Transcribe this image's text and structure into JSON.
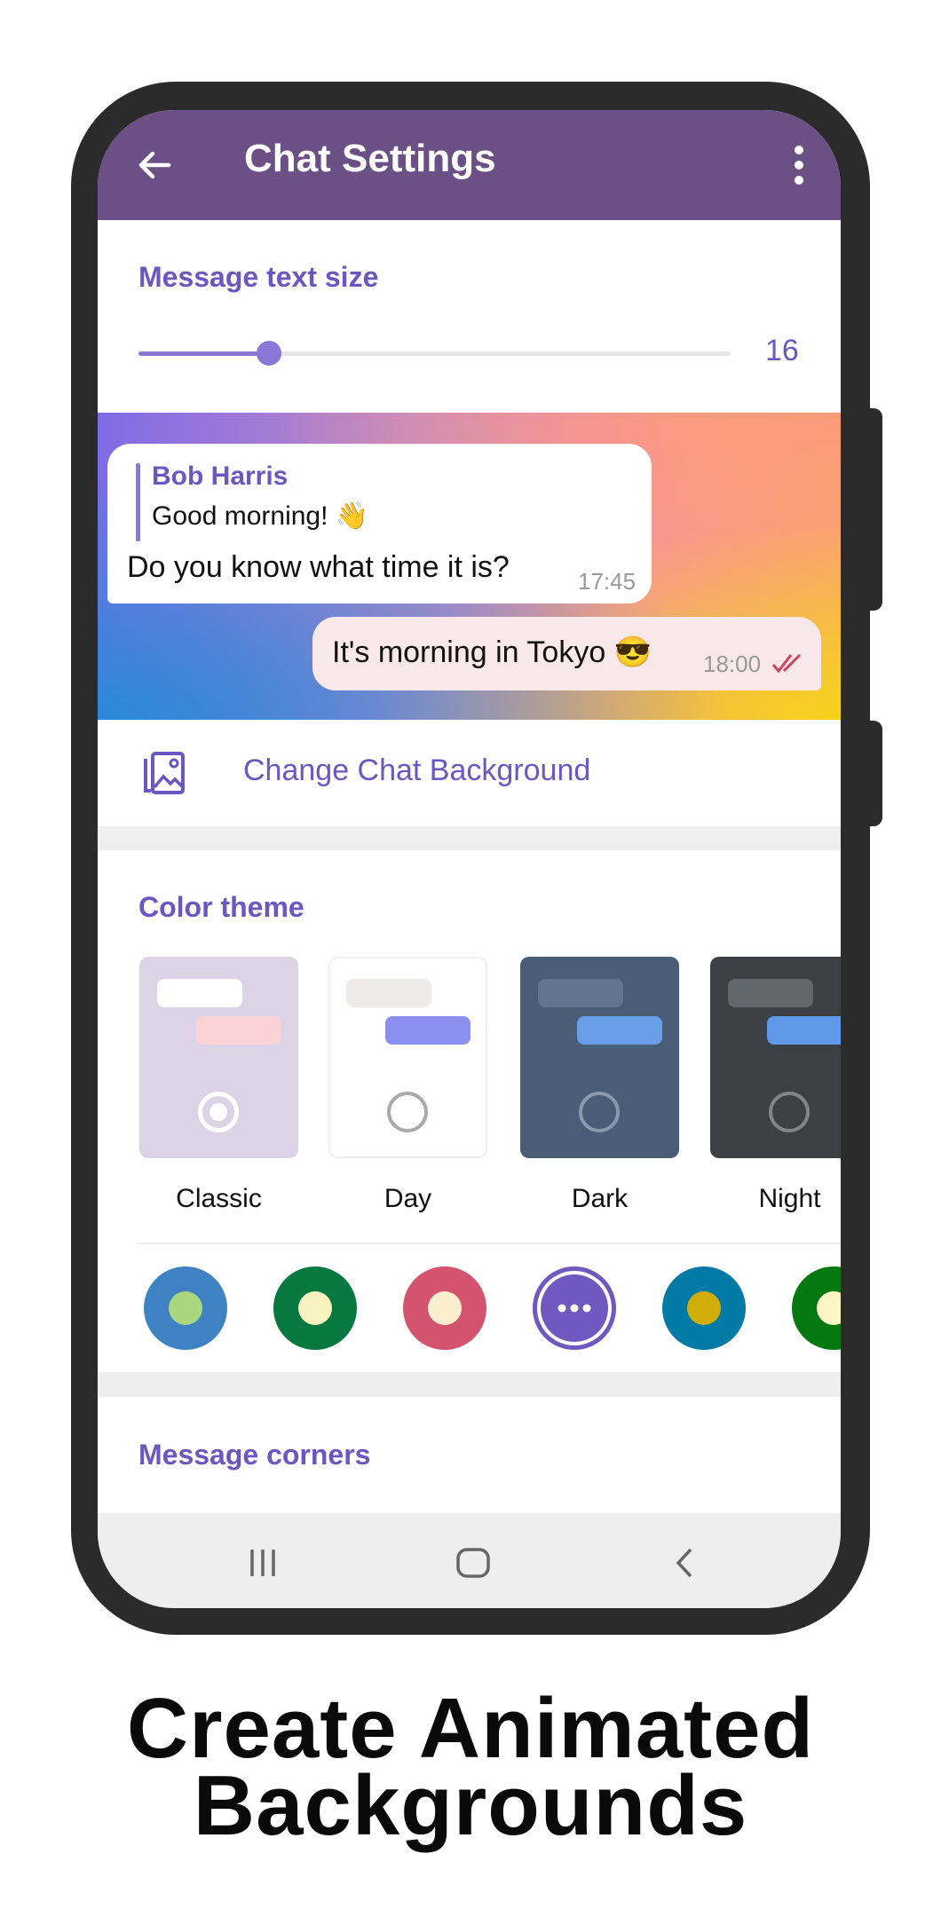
{
  "header": {
    "title": "Chat Settings",
    "back_icon": "arrow-left-icon",
    "menu_icon": "more-vertical-icon"
  },
  "text_size": {
    "label": "Message text size",
    "value": "16",
    "slider_fraction": 0.22
  },
  "preview": {
    "incoming": {
      "reply_sender": "Bob Harris",
      "reply_text": "Good morning! 👋",
      "text": "Do you know what time it is?",
      "time": "17:45"
    },
    "outgoing": {
      "text": "It's morning in Tokyo 😎",
      "time": "18:00",
      "status_icon": "double-check-icon"
    }
  },
  "change_background": {
    "label": "Change Chat Background",
    "icon": "wallpaper-icon"
  },
  "color_theme": {
    "label": "Color theme",
    "themes": [
      {
        "name": "Classic",
        "selected": true
      },
      {
        "name": "Day",
        "selected": false
      },
      {
        "name": "Dark",
        "selected": false
      },
      {
        "name": "Night",
        "selected": false
      }
    ]
  },
  "accents": [
    {
      "outer": "#3f82c4",
      "inner": "#a9d67f"
    },
    {
      "outer": "#07783f",
      "inner": "#f9f3c2"
    },
    {
      "outer": "#d4546f",
      "inner": "#fbefd0"
    },
    {
      "outer": "#7157c0",
      "inner": "more",
      "selected": true
    },
    {
      "outer": "#017ba6",
      "inner": "#d1ad0a"
    },
    {
      "outer": "#05780f",
      "inner": "#fbf6c4"
    }
  ],
  "message_corners": {
    "label": "Message corners"
  },
  "nav": {
    "recents_icon": "recents-icon",
    "home_icon": "home-icon",
    "back_icon": "nav-back-icon"
  },
  "caption": {
    "line1": "Create Animated",
    "line2": "Backgrounds"
  },
  "colors": {
    "header": "#6a5085",
    "accent": "#6b57c2"
  }
}
